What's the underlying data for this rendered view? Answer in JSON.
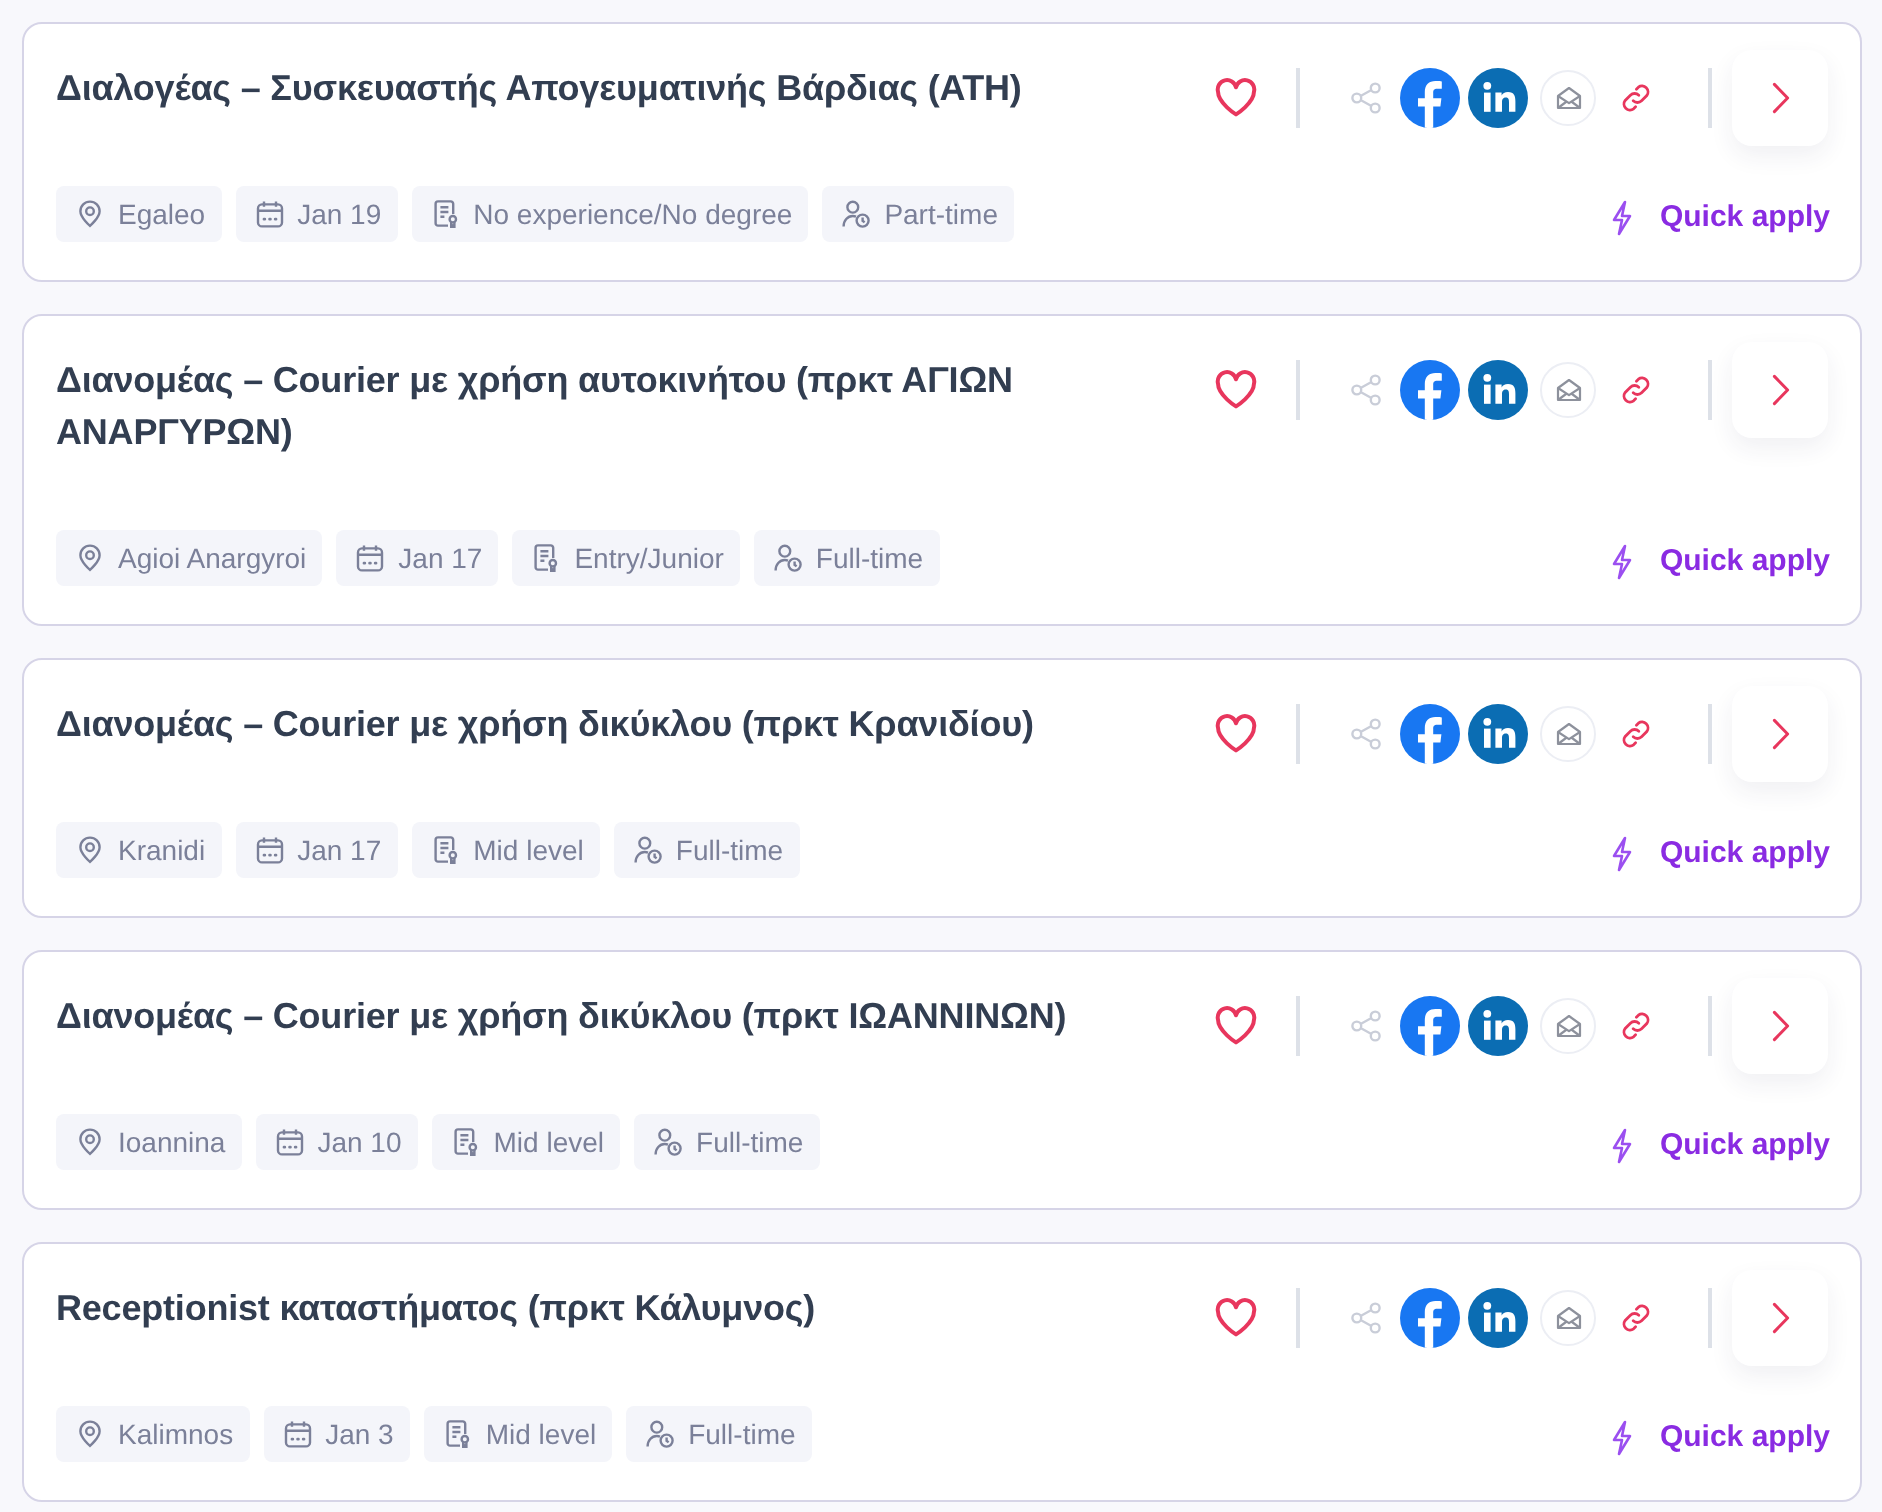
{
  "jobs": [
    {
      "title": "Διαλογέας – Συσκευαστής Απογευματινής Βάρδιας (ΑΤΗ)",
      "saved": false,
      "tags": [
        {
          "kind": "location",
          "text": "Egaleo"
        },
        {
          "kind": "date",
          "text": "Jan 19"
        },
        {
          "kind": "level",
          "text": "No experience/No degree"
        },
        {
          "kind": "schedule",
          "text": "Part-time"
        }
      ],
      "quick_apply": "Quick apply"
    },
    {
      "title": "Διανομέας – Courier με χρήση αυτοκινήτου (πρκτ ΑΓΙΩΝ ΑΝΑΡΓΥΡΩΝ)",
      "saved": false,
      "tags": [
        {
          "kind": "location",
          "text": "Agioi Anargyroi"
        },
        {
          "kind": "date",
          "text": "Jan 17"
        },
        {
          "kind": "level",
          "text": "Entry/Junior"
        },
        {
          "kind": "schedule",
          "text": "Full-time"
        }
      ],
      "quick_apply": "Quick apply"
    },
    {
      "title": "Διανομέας – Courier με χρήση δικύκλου (πρκτ Κρανιδίου)",
      "saved": false,
      "tags": [
        {
          "kind": "location",
          "text": "Kranidi"
        },
        {
          "kind": "date",
          "text": "Jan 17"
        },
        {
          "kind": "level",
          "text": "Mid level"
        },
        {
          "kind": "schedule",
          "text": "Full-time"
        }
      ],
      "quick_apply": "Quick apply"
    },
    {
      "title": "Διανομέας – Courier με χρήση δικύκλου (πρκτ ΙΩΑΝΝΙΝΩΝ)",
      "saved": false,
      "tags": [
        {
          "kind": "location",
          "text": "Ioannina"
        },
        {
          "kind": "date",
          "text": "Jan 10"
        },
        {
          "kind": "level",
          "text": "Mid level"
        },
        {
          "kind": "schedule",
          "text": "Full-time"
        }
      ],
      "quick_apply": "Quick apply"
    },
    {
      "title": "Receptionist καταστήματος (πρκτ Κάλυμνος)",
      "saved": false,
      "tags": [
        {
          "kind": "location",
          "text": "Kalimnos"
        },
        {
          "kind": "date",
          "text": "Jan 3"
        },
        {
          "kind": "level",
          "text": "Mid level"
        },
        {
          "kind": "schedule",
          "text": "Full-time"
        }
      ],
      "quick_apply": "Quick apply"
    }
  ]
}
